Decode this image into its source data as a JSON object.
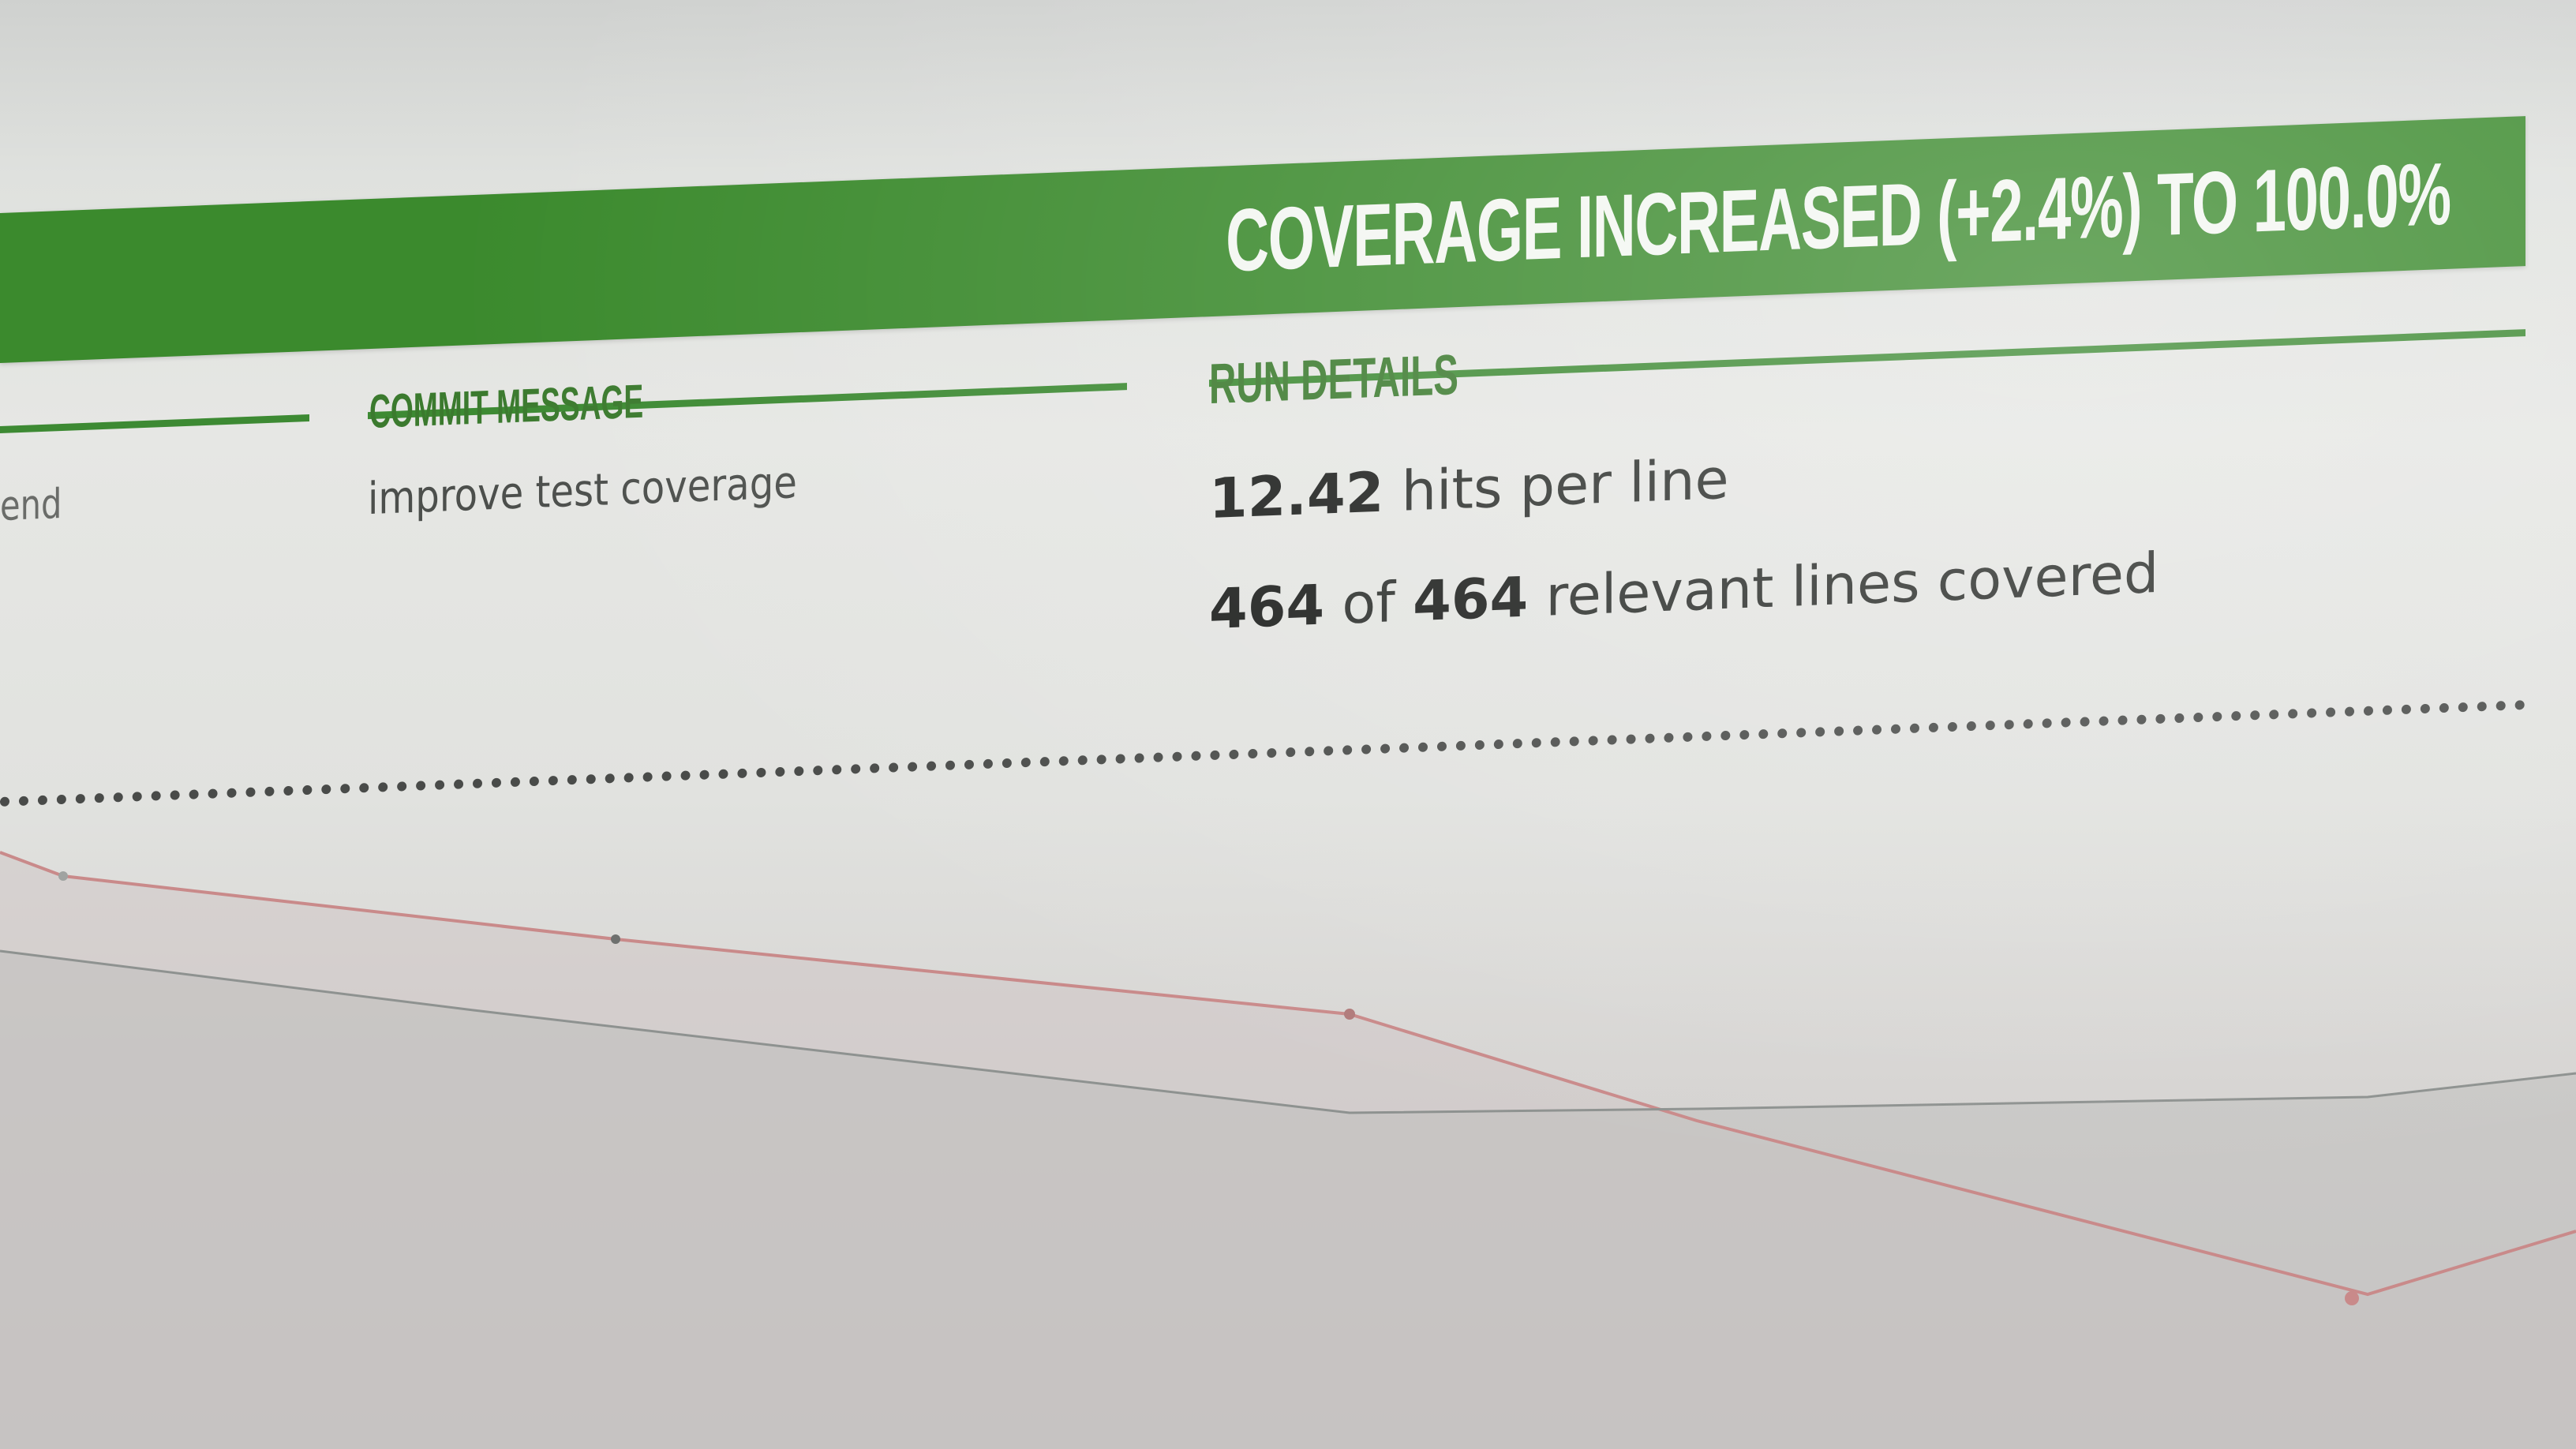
{
  "banner": {
    "title": "COVERAGE INCREASED (+2.4%) TO 100.0%",
    "color": "#3b8a2d"
  },
  "columns": {
    "left_fragment": "end",
    "commit": {
      "heading": "COMMIT MESSAGE",
      "message": "improve test coverage"
    },
    "run": {
      "heading": "RUN DETAILS",
      "hits_value": "12.42",
      "hits_text": "hits per line",
      "covered_value": "464",
      "of_text": "of",
      "relevant_value": "464",
      "relevant_text": "relevant lines covered"
    }
  },
  "colors": {
    "accent": "#3b8a2d",
    "heading": "#3b7a2e",
    "trend_line": "#c98a8a"
  }
}
